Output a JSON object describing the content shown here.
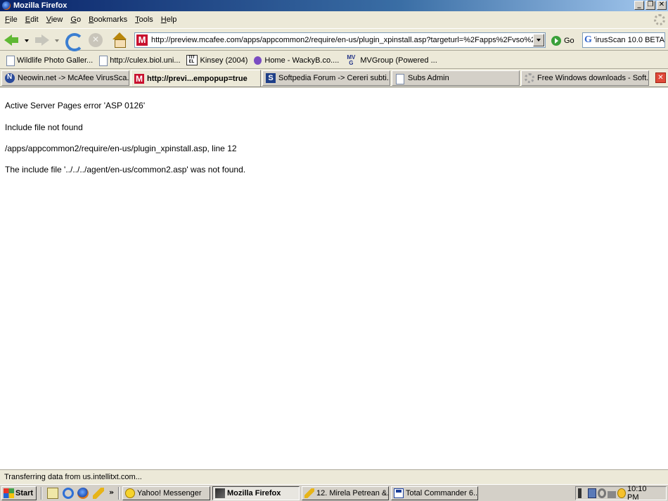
{
  "window": {
    "title": "Mozilla Firefox"
  },
  "menu": [
    "File",
    "Edit",
    "View",
    "Go",
    "Bookmarks",
    "Tools",
    "Help"
  ],
  "nav": {
    "url": "http://preview.mcafee.com/apps/appcommon2/require/en-us/plugin_xpinstall.asp?targeturl=%2Fapps%2Fvso%2Fen%2",
    "go_label": "Go",
    "search_value": "'irusScan 10.0 BETA"
  },
  "bookmarks": [
    {
      "label": "Wildlife Photo Galler...",
      "icon": "page-icon"
    },
    {
      "label": "http://culex.biol.uni...",
      "icon": "page-icon"
    },
    {
      "label": "Kinsey (2004)",
      "icon": "imdb-icon"
    },
    {
      "label": "Home - WackyB.co....",
      "icon": "bug-icon"
    },
    {
      "label": "MVGroup (Powered ...",
      "icon": "mvg-icon"
    }
  ],
  "tabs": [
    {
      "label": "Neowin.net -> McAfee VirusSca...",
      "icon": "neowin-icon"
    },
    {
      "label": "http://previ...empopup=true",
      "icon": "mcafee-icon"
    },
    {
      "label": "Softpedia Forum -> Cereri subti...",
      "icon": "softpedia-icon"
    },
    {
      "label": "Subs Admin",
      "icon": "page-icon"
    },
    {
      "label": "Free Windows downloads - Soft...",
      "icon": "spinner-icon"
    }
  ],
  "content": {
    "error_title": "Active Server Pages error 'ASP 0126'",
    "error_type": "Include file not found",
    "error_location": "/apps/appcommon2/require/en-us/plugin_xpinstall.asp, line 12",
    "error_detail": "The include file '../../../agent/en-us/common2.asp' was not found."
  },
  "status": {
    "text": "Transferring data from us.intellitxt.com..."
  },
  "taskbar": {
    "start_label": "Start",
    "more_glyph": "»",
    "tasks": [
      {
        "label": "Yahoo! Messenger",
        "icon": "yahoo-icon"
      },
      {
        "label": "Mozilla Firefox",
        "icon": "firefox-icon"
      },
      {
        "label": "12. Mirela Petrean &...",
        "icon": "chat-icon"
      },
      {
        "label": "Total Commander 6....",
        "icon": "total-commander-icon"
      }
    ],
    "clock": "10:10 PM"
  }
}
